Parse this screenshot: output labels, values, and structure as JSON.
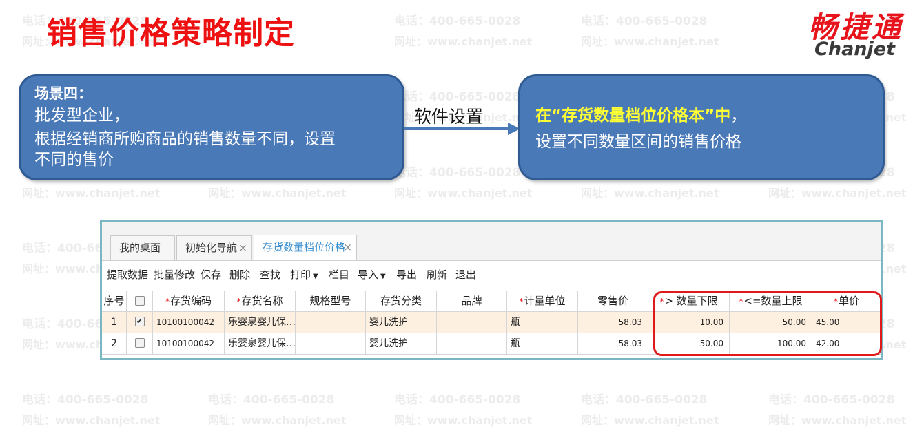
{
  "page": {
    "title": "销售价格策略制定"
  },
  "brand": {
    "name_cn": "畅捷通",
    "name_en": "Chanjet"
  },
  "watermark": {
    "phone": "电话：400-665-0028",
    "site": "网址：www.chanjet.net"
  },
  "scenario": {
    "heading": "场景四：",
    "line1": "批发型企业，",
    "line2": "根据经销商所购商品的销售数量不同，设置",
    "line3": "不同的售价"
  },
  "arrow_label": "软件设置",
  "solution": {
    "highlight": "在“存货数量档位价格本”中",
    "highlight_suffix": "，",
    "line2": "设置不同数量区间的销售价格"
  },
  "app": {
    "tabs": [
      {
        "label": "我的桌面",
        "closable": false
      },
      {
        "label": "初始化导航",
        "closable": true
      },
      {
        "label": "存货数量档位价格",
        "closable": true,
        "active": true
      }
    ],
    "close_glyph": "×",
    "toolbar": [
      "提取数据",
      "批量修改",
      "保存",
      "删除",
      "查找",
      "打印",
      "栏目",
      "导入",
      "导出",
      "刷新",
      "退出"
    ],
    "dropdown_caret": "▼",
    "columns": [
      "序号",
      "",
      "存货编码",
      "存货名称",
      "规格型号",
      "存货分类",
      "品牌",
      "计量单位",
      "零售价",
      "> 数量下限",
      "<=数量上限",
      "单价"
    ],
    "required_mark": "*",
    "rows": [
      {
        "seq": "1",
        "checked": true,
        "code": "10100100042",
        "name": "乐婴泉婴儿保…",
        "spec": "",
        "category": "婴儿洗护",
        "brand": "",
        "unit": "瓶",
        "retail": "58.03",
        "min_qty": "10.00",
        "max_qty": "50.00",
        "price": "45.00"
      },
      {
        "seq": "2",
        "checked": false,
        "code": "10100100042",
        "name": "乐婴泉婴儿保…",
        "spec": "",
        "category": "婴儿洗护",
        "brand": "",
        "unit": "瓶",
        "retail": "58.03",
        "min_qty": "50.00",
        "max_qty": "100.00",
        "price": "42.00"
      }
    ],
    "check_glyph": "✔"
  },
  "colors": {
    "title_red": "#ee1111",
    "bubble_fill": "#4a79b8",
    "highlight_yellow": "#ffff33",
    "tab_active_text": "#3a8fd0",
    "window_border": "#7bb7c2",
    "frame_red": "#e01a1a"
  }
}
